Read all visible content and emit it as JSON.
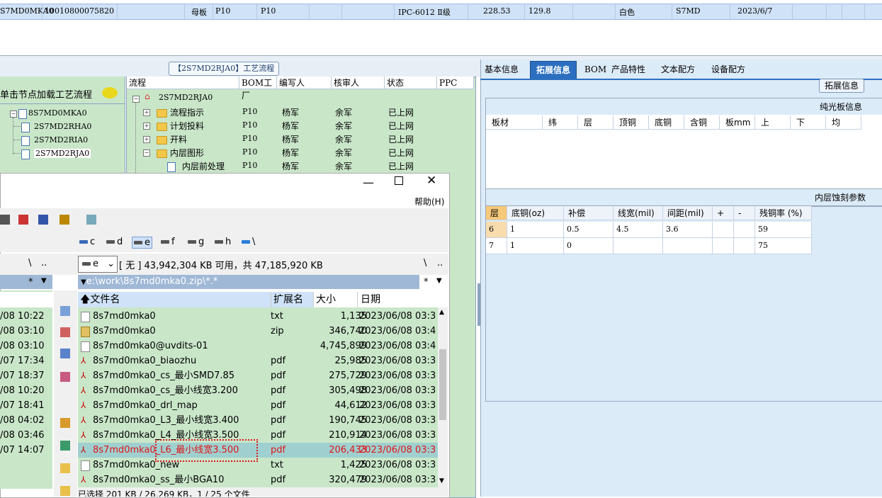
{
  "top_row": {
    "col1": "S7MD0MKA0",
    "col2": "10010800075820",
    "col3": "母板",
    "col4": "P10",
    "col5": "P10",
    "col6": "IPC-6012 Ⅱ级",
    "col7": "228.53",
    "col8": "129.8",
    "col9": "白色",
    "col10": "S7MD",
    "col11": "2023/6/7"
  },
  "right_panel": {
    "tabs": [
      "基本信息",
      "拓展信息",
      "BOM",
      "产品特性",
      "文本配方",
      "设备配方"
    ],
    "active_tab": "拓展信息",
    "ext_button": "拓展信息",
    "polish_title": "纯光板信息",
    "polish_headers": [
      "板材",
      "纬",
      "层",
      "顶铜",
      "底铜",
      "含铜",
      "板mm",
      "上",
      "下",
      "均"
    ],
    "etch_title": "内层蚀刻参数",
    "etch_headers": [
      "层",
      "底铜(oz)",
      "补偿",
      "线宽(mil)",
      "间距(mil)",
      "+",
      "-",
      "残铜率 (%)"
    ],
    "etch_rows": [
      [
        "6",
        "1",
        "0.5",
        "4.5",
        "3.6",
        "",
        "",
        "59"
      ],
      [
        "7",
        "1",
        "0",
        "",
        "",
        "",
        "",
        "75"
      ]
    ]
  },
  "flow": {
    "title": "【2S7MD2RJA0】工艺流程",
    "headers": [
      "流程",
      "BOM工厂",
      "编写人",
      "核审人",
      "状态",
      "PPC"
    ],
    "root": "2S7MD2RJA0",
    "rows": [
      {
        "name": "流程指示",
        "bom": "P10",
        "writer": "杨军",
        "checker": "余军",
        "status": "已上网"
      },
      {
        "name": "计划投料",
        "bom": "P10",
        "writer": "杨军",
        "checker": "余军",
        "status": "已上网"
      },
      {
        "name": "开料",
        "bom": "P10",
        "writer": "杨军",
        "checker": "余军",
        "status": "已上网"
      },
      {
        "name": "内层图形",
        "bom": "P10",
        "writer": "杨军",
        "checker": "余军",
        "status": "已上网"
      },
      {
        "name": "内层前处理",
        "bom": "P10",
        "writer": "杨军",
        "checker": "余军",
        "status": "已上网"
      }
    ]
  },
  "tree": {
    "hint": "单击节点加载工艺流程",
    "root": "8S7MD0MKA0",
    "children": [
      "2S7MD2RHA0",
      "2S7MD2RIA0",
      "2S7MD2RJA0"
    ]
  },
  "file_manager": {
    "help_menu": "帮助(H)",
    "drives": [
      "c",
      "d",
      "e",
      "f",
      "g",
      "h",
      "\\"
    ],
    "drive_select": "e",
    "free_space": "[ 无 ]  43,942,304 KB 可用，共 47,185,920 KB",
    "nav_back": "\\",
    "nav_up": "..",
    "nav_back2": "\\",
    "nav_up2": "..",
    "filter_left": "*",
    "filter_right": "*",
    "path": "e:\\work\\8s7md0mka0.zip\\*.*",
    "columns": [
      "文件名",
      "扩展名",
      "大小",
      "日期"
    ],
    "left_dates": [
      "/08 10:22",
      "/08 03:10",
      "/08 03:10",
      "/07 17:34",
      "/07 18:37",
      "/08 10:20",
      "/07 18:41",
      "/08 04:02",
      "/08 03:46",
      "/07 14:07"
    ],
    "files": [
      {
        "name": "8s7md0mka0",
        "ext": "txt",
        "size": "1,135",
        "date": "2023/06/08 03:3"
      },
      {
        "name": "8s7md0mka0",
        "ext": "zip",
        "size": "346,740",
        "date": "2023/06/08 03:4"
      },
      {
        "name": "8s7md0mka0@uvdits-01",
        "ext": "",
        "size": "4,745,899",
        "date": "2023/06/08 03:4"
      },
      {
        "name": "8s7md0mka0_biaozhu",
        "ext": "pdf",
        "size": "25,985",
        "date": "2023/06/08 03:3"
      },
      {
        "name": "8s7md0mka0_cs_最小SMD7.85",
        "ext": "pdf",
        "size": "275,729",
        "date": "2023/06/08 03:3"
      },
      {
        "name": "8s7md0mka0_cs_最小线宽3.200",
        "ext": "pdf",
        "size": "305,498",
        "date": "2023/06/08 03:3"
      },
      {
        "name": "8s7md0mka0_drl_map",
        "ext": "pdf",
        "size": "44,612",
        "date": "2023/06/08 03:3"
      },
      {
        "name": "8s7md0mka0_L3_最小线宽3.400",
        "ext": "pdf",
        "size": "190,745",
        "date": "2023/06/08 03:3"
      },
      {
        "name": "8s7md0mka0_L4_最小线宽3.500",
        "ext": "pdf",
        "size": "210,914",
        "date": "2023/06/08 03:3"
      },
      {
        "name": "8s7md0mka0_L6_最小线宽3.500",
        "ext": "pdf",
        "size": "206,433",
        "date": "2023/06/08 03:3"
      },
      {
        "name": "8s7md0mka0_new",
        "ext": "txt",
        "size": "1,425",
        "date": "2023/06/08 03:3"
      },
      {
        "name": "8s7md0mka0_ss_最小BGA10",
        "ext": "pdf",
        "size": "320,479",
        "date": "2023/06/08 03:3"
      }
    ],
    "status": "已选择 201 KB / 26,269 KB，1 / 25 个文件"
  }
}
